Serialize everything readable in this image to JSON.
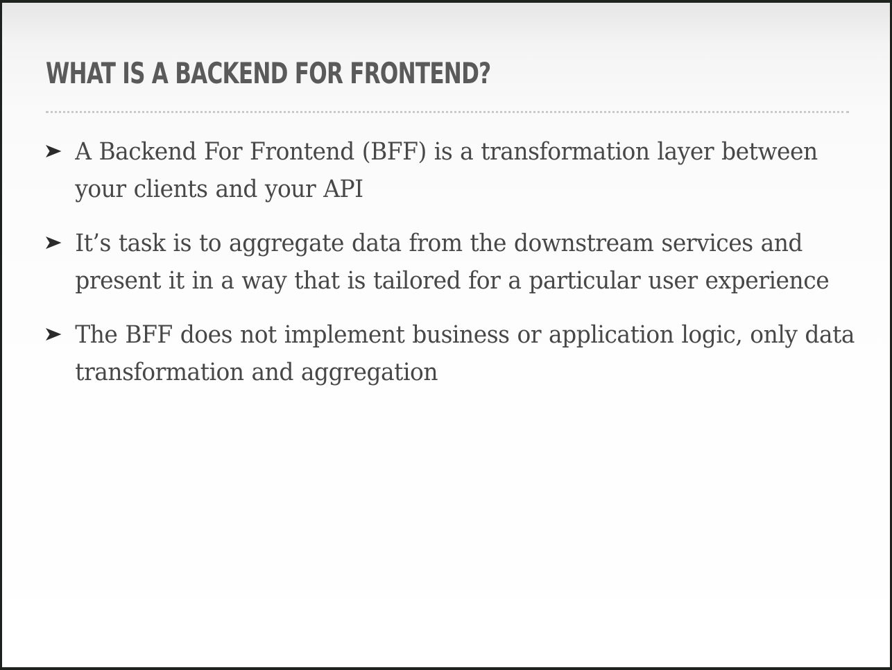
{
  "slide": {
    "title": "WHAT IS A BACKEND FOR FRONTEND?",
    "bullets": [
      "A Backend For Frontend (BFF) is a transformation layer between your clients and your API",
      "It’s task is to aggregate data from the downstream services and present it in a way that is tailored for a particular user experience",
      "The BFF does not implement business or application logic, only data transformation and aggregation"
    ],
    "bullet_icon": "arrowhead-bullet-icon",
    "colors": {
      "title": "#5a5a5a",
      "body_text": "#474747",
      "rule": "#c9c9c9",
      "background": "#fafafa"
    }
  }
}
